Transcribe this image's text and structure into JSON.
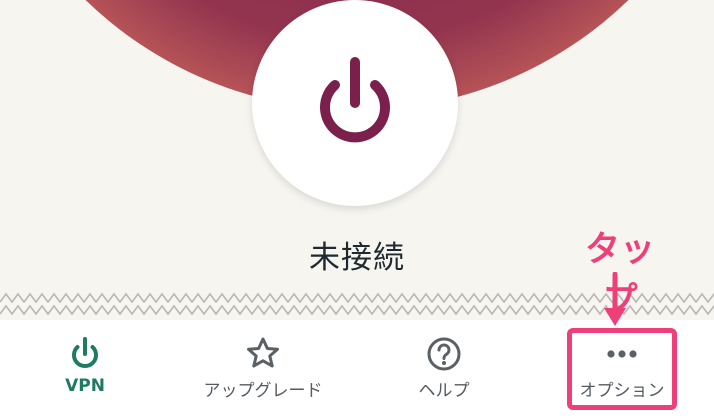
{
  "main": {
    "status": "未接続"
  },
  "nav": {
    "items": [
      {
        "id": "vpn",
        "label": "VPN",
        "icon": "power-icon",
        "active": true
      },
      {
        "id": "upgrade",
        "label": "アップグレード",
        "icon": "star-icon",
        "active": false
      },
      {
        "id": "help",
        "label": "ヘルプ",
        "icon": "question-circle-icon",
        "active": false
      },
      {
        "id": "options",
        "label": "オプション",
        "icon": "more-dots-icon",
        "active": false
      }
    ]
  },
  "annotation": {
    "text": "タップ",
    "target": "options"
  },
  "colors": {
    "accent_green": "#1f7a63",
    "power_icon": "#7b1f4c",
    "annotation": "#ef3f7b",
    "cream": "#f7f5f0"
  }
}
